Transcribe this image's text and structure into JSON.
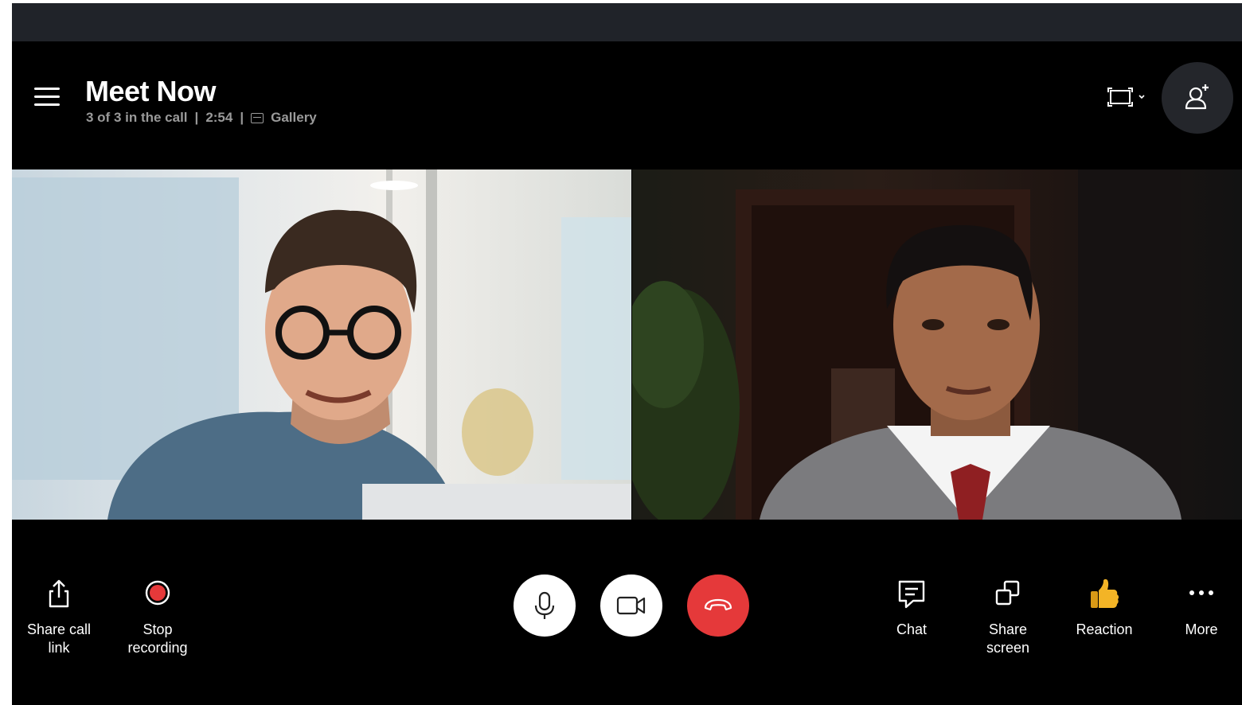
{
  "header": {
    "title": "Meet Now",
    "participants": "3 of 3 in the call",
    "separator": "|",
    "duration": "2:54",
    "view_mode": "Gallery"
  },
  "controls": {
    "left": [
      {
        "label": "Share call\nlink",
        "icon": "share-icon"
      },
      {
        "label": "Stop\nrecording",
        "icon": "record-icon",
        "color": "#e5393a"
      }
    ],
    "center": [
      {
        "icon": "microphone-icon",
        "background": "#ffffff"
      },
      {
        "icon": "video-camera-icon",
        "background": "#ffffff"
      },
      {
        "icon": "end-call-icon",
        "background": "#e5393a"
      }
    ],
    "right": [
      {
        "label": "Chat",
        "icon": "chat-icon"
      },
      {
        "label": "Share\nscreen",
        "icon": "share-screen-icon"
      },
      {
        "label": "Reaction",
        "icon": "thumbs-up-icon",
        "color": "#f3b426"
      },
      {
        "label": "More",
        "icon": "more-dots-icon"
      }
    ]
  },
  "colors": {
    "background": "#000000",
    "titlebar": "#202329",
    "accent_red": "#e5393a",
    "subtitle_gray": "#9a9a9a"
  }
}
